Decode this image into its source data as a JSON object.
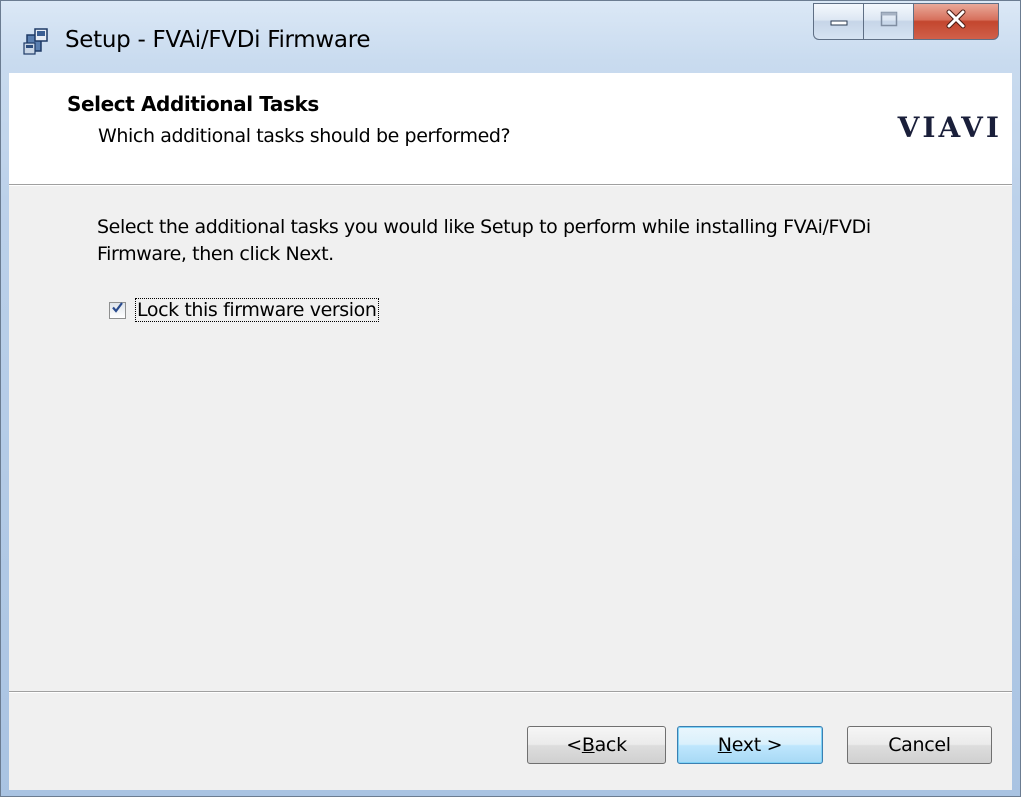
{
  "window": {
    "title": "Setup - FVAi/FVDi Firmware",
    "icon": "setup-installer-icon"
  },
  "caption_buttons": {
    "minimize_icon": "minimize-icon",
    "maximize_icon": "maximize-icon",
    "close_icon": "close-icon"
  },
  "header": {
    "title": "Select Additional Tasks",
    "subtitle": "Which additional tasks should be performed?",
    "logo_text": "VIAVI"
  },
  "body": {
    "description": "Select the additional tasks you would like Setup to perform while installing FVAi/FVDi Firmware, then click Next.",
    "tasks": [
      {
        "label": "Lock this firmware version",
        "checked": true
      }
    ]
  },
  "footer": {
    "back": {
      "prefix": "< ",
      "accel": "B",
      "rest": "ack"
    },
    "next": {
      "accel": "N",
      "rest": "ext >"
    },
    "cancel": "Cancel"
  },
  "colors": {
    "frame": "#bcd1ea",
    "close_button": "#c3462e",
    "default_button_border": "#3c7fb1",
    "logo": "#1a1f3a"
  }
}
